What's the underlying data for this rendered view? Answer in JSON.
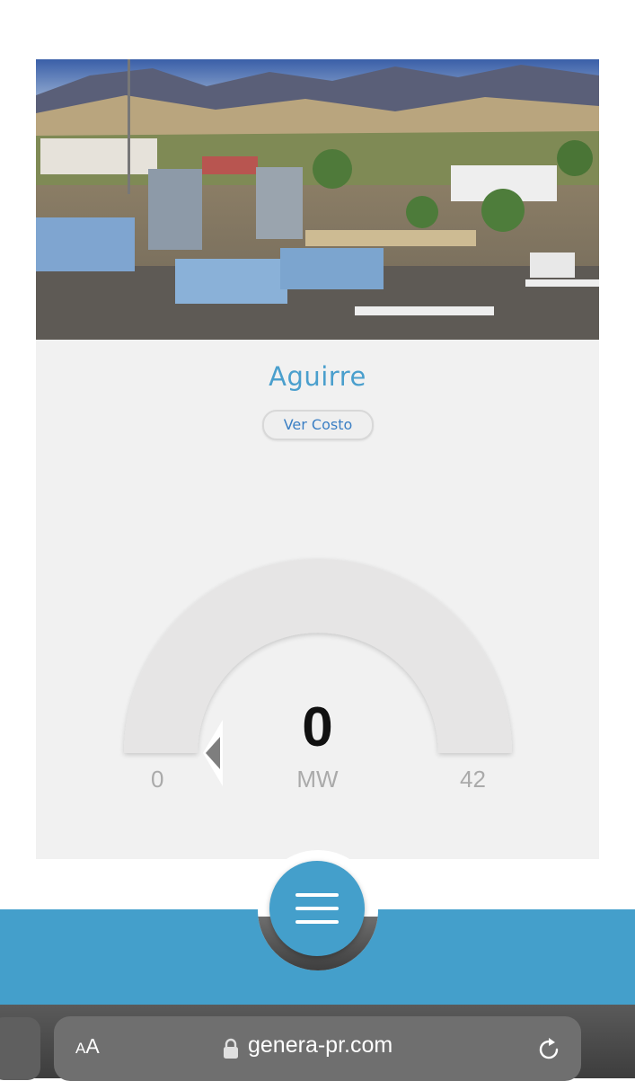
{
  "plant": {
    "name": "Aguirre",
    "cost_button_label": "Ver Costo"
  },
  "gauge": {
    "value": "0",
    "unit": "MW",
    "min": "0",
    "max": "42",
    "fill_fraction": 0
  },
  "menu": {
    "icon": "hamburger-menu-icon"
  },
  "browser": {
    "aa_small": "A",
    "aa_big": "A",
    "url": "genera-pr.com",
    "lock_icon": "lock-icon",
    "reload_icon": "reload-icon"
  },
  "colors": {
    "accent": "#449fcb",
    "title": "#4a9fcd",
    "card_bg": "#f1f1f1"
  }
}
